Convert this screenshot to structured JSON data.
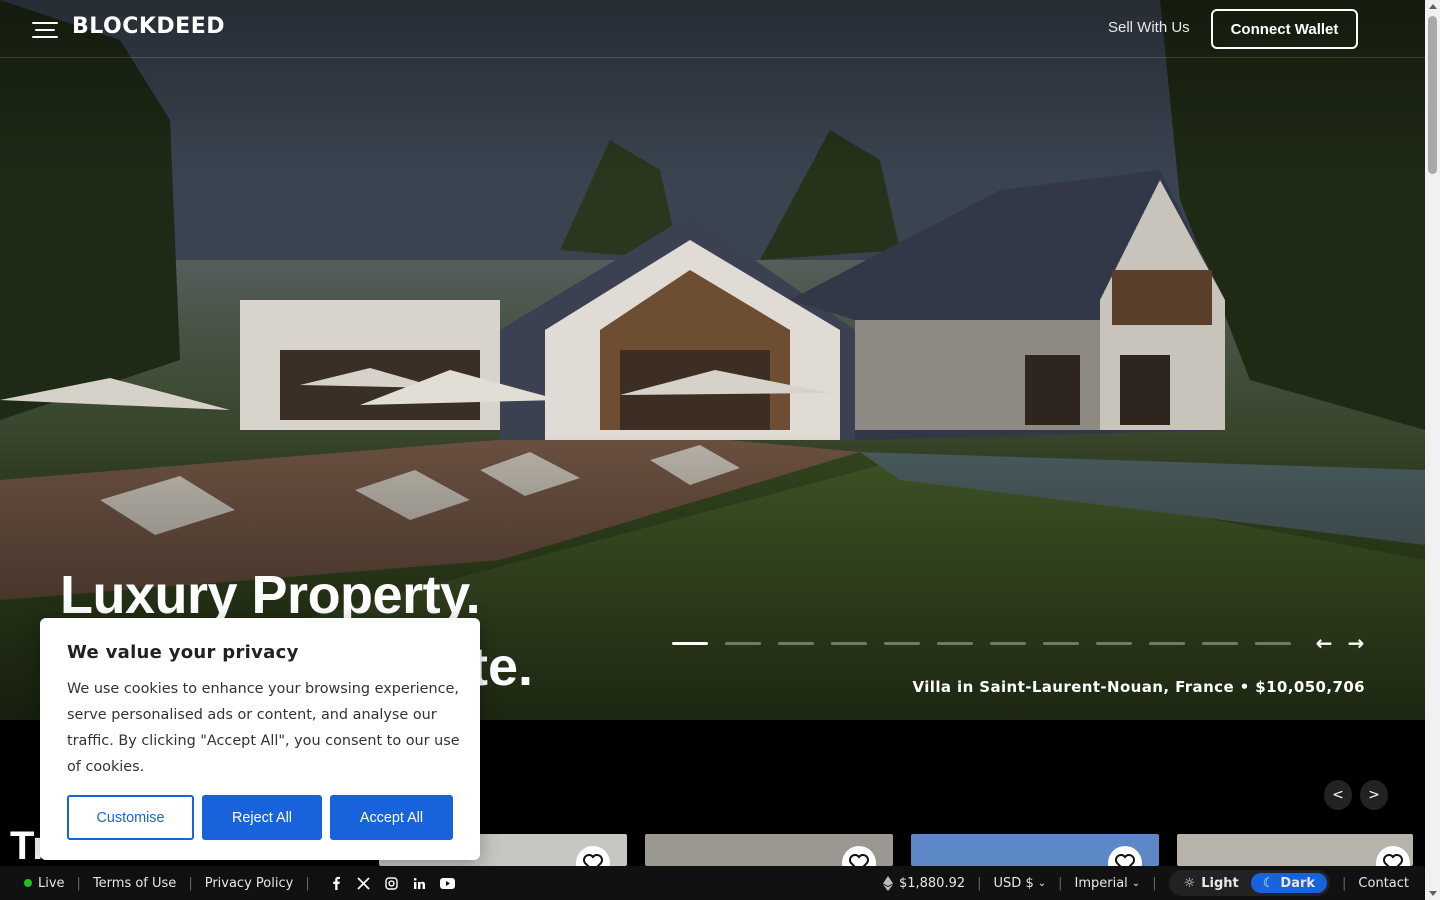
{
  "nav": {
    "logo": "BLOCKDEED",
    "sell_link": "Sell With Us",
    "connect_button": "Connect Wallet"
  },
  "hero": {
    "headline_line1": "Luxury Property.",
    "headline_line2_visible": "te.",
    "caption": "Villa in Saint-Laurent-Nouan, France • $10,050,706",
    "slide_count": 12,
    "active_slide": 1,
    "prev_arrow": "←",
    "next_arrow": "→"
  },
  "listings": {
    "title_visible": "Tr",
    "prev_label": "<",
    "next_label": ">",
    "cards": [
      {
        "name": "card-1",
        "favorite_icon": "heart-icon"
      },
      {
        "name": "card-2",
        "favorite_icon": "heart-icon"
      },
      {
        "name": "card-3",
        "favorite_icon": "heart-icon"
      },
      {
        "name": "card-4",
        "favorite_icon": "heart-icon"
      }
    ]
  },
  "cookie": {
    "title": "We value your privacy",
    "body": "We use cookies to enhance your browsing experience, serve personalised ads or content, and analyse our traffic. By clicking \"Accept All\", you consent to our use of cookies.",
    "customise": "Customise",
    "reject": "Reject All",
    "accept": "Accept All"
  },
  "footer": {
    "live": "Live",
    "terms": "Terms of Use",
    "privacy": "Privacy Policy",
    "eth_price": "$1,880.92",
    "currency": "USD $",
    "units": "Imperial",
    "theme_light": "Light",
    "theme_dark": "Dark",
    "contact": "Contact"
  },
  "colors": {
    "accent": "#1863dc",
    "live": "#20c020"
  }
}
